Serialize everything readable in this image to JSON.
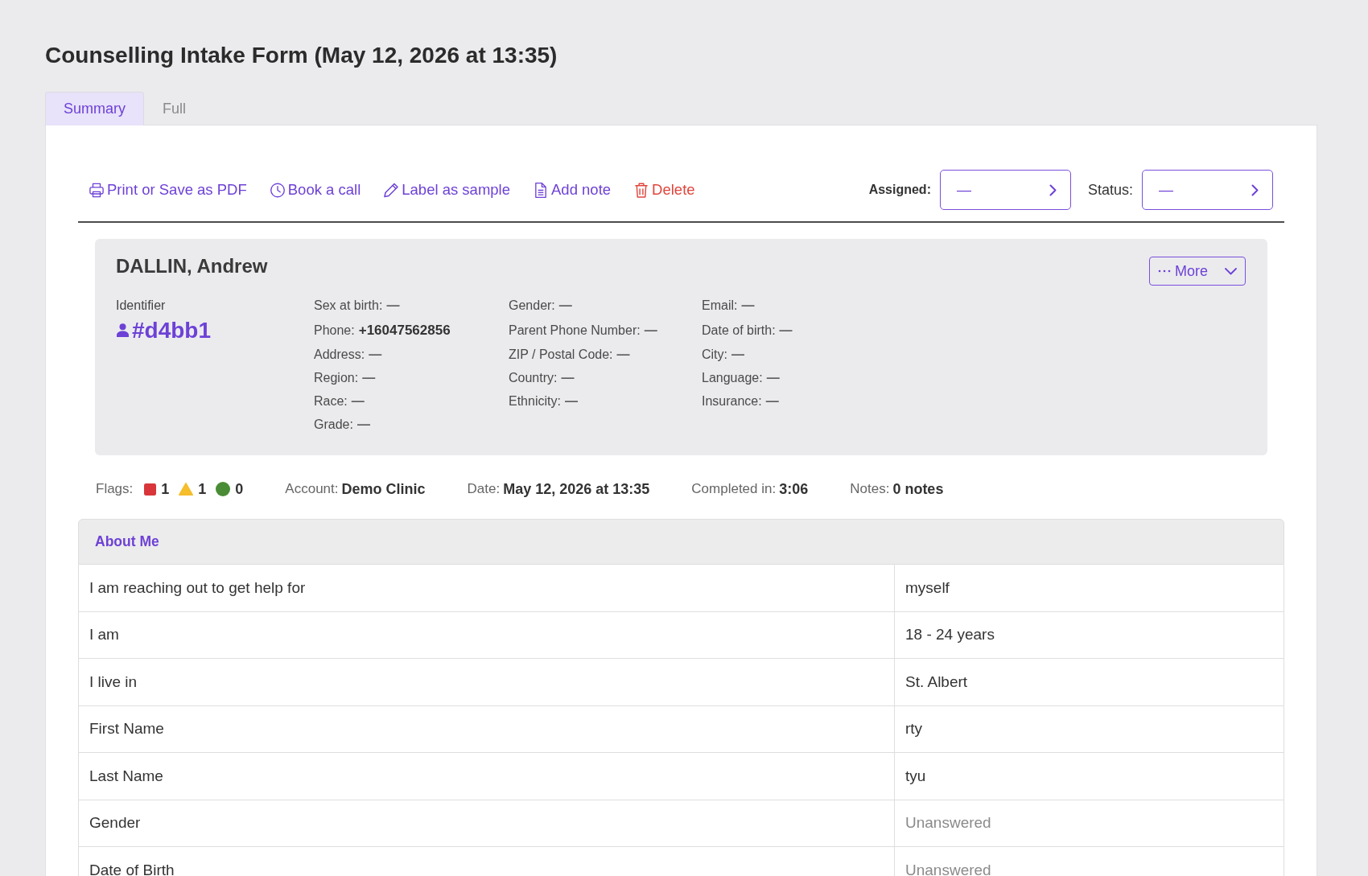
{
  "title": "Counselling Intake Form (May 12, 2026 at 13:35)",
  "tabs": [
    {
      "label": "Summary",
      "selected": true
    },
    {
      "label": "Full",
      "selected": false
    }
  ],
  "toolbar": {
    "actions": [
      {
        "kind": "print",
        "label": "Print or Save as PDF"
      },
      {
        "kind": "call",
        "label": "Book a call"
      },
      {
        "kind": "label",
        "label": "Label as sample"
      },
      {
        "kind": "note",
        "label": "Add note"
      },
      {
        "kind": "delete",
        "label": "Delete"
      }
    ],
    "selectors": [
      {
        "kind": "assigned",
        "label": "Assigned:",
        "value": "—"
      },
      {
        "kind": "status",
        "label": "Status:",
        "value": "—"
      }
    ]
  },
  "patient": {
    "name": "DALLIN, Andrew",
    "more_button": "More",
    "identifier_label": "Identifier",
    "identifier": "#d4bb1",
    "field_rows": [
      [
        {
          "label": "Sex at birth:",
          "value": "—",
          "answered": false
        },
        {
          "label": "Gender:",
          "value": "—",
          "answered": false
        },
        {
          "label": "Email:",
          "value": "—",
          "answered": false
        }
      ],
      [
        {
          "label": "Phone:",
          "value": "+16047562856",
          "answered": true
        },
        {
          "label": "Parent Phone Number:",
          "value": "—",
          "answered": false
        },
        {
          "label": "Date of birth:",
          "value": "—",
          "answered": false
        }
      ],
      [
        {
          "label": "Address:",
          "value": "—",
          "answered": false
        },
        {
          "label": "ZIP / Postal Code:",
          "value": "—",
          "answered": false
        },
        {
          "label": "City:",
          "value": "—",
          "answered": false
        }
      ],
      [
        {
          "label": "Region:",
          "value": "—",
          "answered": false
        },
        {
          "label": "Country:",
          "value": "—",
          "answered": false
        },
        {
          "label": "Language:",
          "value": "—",
          "answered": false
        }
      ],
      [
        {
          "label": "Race:",
          "value": "—",
          "answered": false
        },
        {
          "label": "Ethnicity:",
          "value": "—",
          "answered": false
        },
        {
          "label": "Insurance:",
          "value": "—",
          "answered": false
        }
      ],
      [
        {
          "label": "Grade:",
          "value": "—",
          "answered": false
        }
      ]
    ]
  },
  "flags": {
    "label": "Flags:",
    "items": [
      {
        "kind": "square",
        "color": "#d8363a",
        "count": "1"
      },
      {
        "kind": "triangle",
        "color": "#f6bd2c",
        "count": "1"
      },
      {
        "kind": "circle",
        "color": "#4a8c35",
        "count": "0"
      }
    ]
  },
  "summary_items": [
    {
      "label": "Account:",
      "value": "Demo Clinic"
    },
    {
      "label": "Date:",
      "value": "May 12, 2026 at 13:35"
    },
    {
      "label": "Completed in:",
      "value": "3:06"
    },
    {
      "label": "Notes:",
      "value": "0 notes"
    }
  ],
  "section": {
    "title": "About Me",
    "rows": [
      {
        "question": "I am reaching out to get help for",
        "answer": "myself",
        "answered": true
      },
      {
        "question": "I am",
        "answer": "18 - 24 years",
        "answered": true
      },
      {
        "question": "I live in",
        "answer": "St. Albert",
        "answered": true
      },
      {
        "question": "First Name",
        "answer": "rty",
        "answered": true
      },
      {
        "question": "Last Name",
        "answer": "tyu",
        "answered": true
      },
      {
        "question": "Gender",
        "answer": "Unanswered",
        "answered": false
      },
      {
        "question": "Date of Birth",
        "answer": "Unanswered",
        "answered": false
      }
    ]
  }
}
